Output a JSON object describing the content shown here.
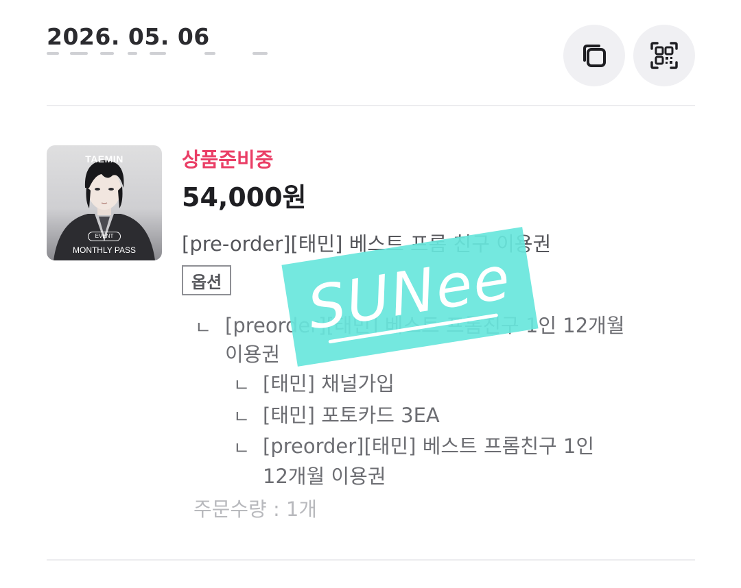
{
  "order": {
    "date": "2026. 05. 06"
  },
  "actions": {
    "copy_icon": "copy-icon",
    "qr_icon": "qr-code-icon"
  },
  "product": {
    "thumbnail": {
      "title": "TAEMIN",
      "event_label": "EVENT",
      "pass_label": "MONTHLY PASS"
    },
    "status": "상품준비중",
    "status_color": "#ea3e66",
    "price": "54,000원",
    "name": "[pre-order][태민] 베스트 프롬 친구 이용권",
    "option_badge": "옵션",
    "option_marker": "ㄴ",
    "options": [
      {
        "level": 1,
        "line1": "[preorder][태민] 베스트 프롬친구 1인 12개월",
        "line2": "이용권"
      },
      {
        "level": 2,
        "line1": "[태민] 채널가입"
      },
      {
        "level": 2,
        "line1": "[태민] 포토카드 3EA"
      },
      {
        "level": 2,
        "line1": "[preorder][태민] 베스트 프롬친구 1인",
        "line2": "12개월 이용권"
      }
    ],
    "quantity": "주문수량 : 1개"
  },
  "watermark": {
    "text": "SUNee",
    "color": "#68e6dc"
  }
}
